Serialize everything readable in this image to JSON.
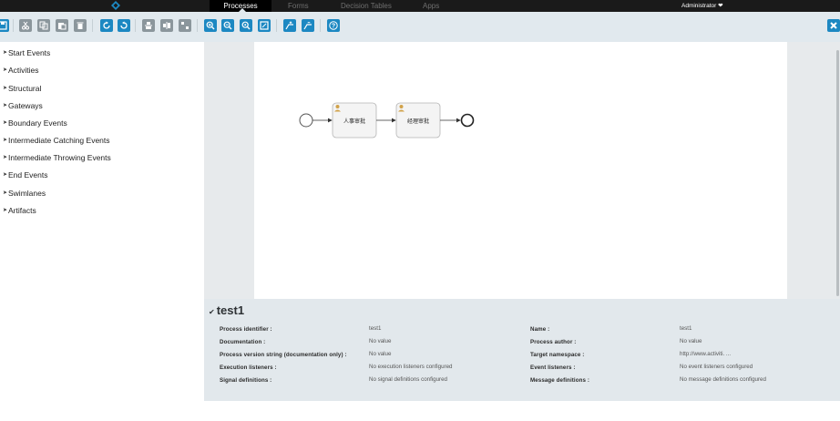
{
  "nav": {
    "tabs": [
      {
        "label": "Processes",
        "active": true
      },
      {
        "label": "Forms",
        "active": false
      },
      {
        "label": "Decision Tables",
        "active": false
      },
      {
        "label": "Apps",
        "active": false
      }
    ],
    "user": "Administrator"
  },
  "toolbar": {
    "buttons": [
      "save-icon",
      "cut-icon",
      "copy-icon",
      "paste-icon",
      "delete-icon",
      "redo-icon",
      "undo-icon",
      "align-vertical-icon",
      "align-horizontal-icon",
      "same-size-icon",
      "zoom-in-icon",
      "zoom-out-icon",
      "zoom-actual-icon",
      "zoom-fit-icon",
      "bendpoint-add-icon",
      "bendpoint-remove-icon",
      "help-icon",
      "close-icon"
    ]
  },
  "palette": {
    "items": [
      "Start Events",
      "Activities",
      "Structural",
      "Gateways",
      "Boundary Events",
      "Intermediate Catching Events",
      "Intermediate Throwing Events",
      "End Events",
      "Swimlanes",
      "Artifacts"
    ]
  },
  "diagram": {
    "tasks": [
      {
        "label": "人事审批"
      },
      {
        "label": "经理审批"
      }
    ]
  },
  "properties": {
    "title": "test1",
    "rows": [
      {
        "l1": "Process identifier :",
        "v1": "test1",
        "l2": "Name :",
        "v2": "test1"
      },
      {
        "l1": "Documentation :",
        "v1": "No value",
        "l2": "Process author :",
        "v2": "No value"
      },
      {
        "l1": "Process version string (documentation only) :",
        "v1": "No value",
        "l2": "Target namespace :",
        "v2": "http://www.activiti. ..."
      },
      {
        "l1": "Execution listeners :",
        "v1": "No execution listeners configured",
        "l2": "Event listeners :",
        "v2": "No event listeners configured"
      },
      {
        "l1": "Signal definitions :",
        "v1": "No signal definitions configured",
        "l2": "Message definitions :",
        "v2": "No message definitions configured"
      }
    ]
  },
  "colors": {
    "accent": "#1c88c2",
    "toolbar_bg": "#e1e9ee",
    "nav_bg": "#1a1a1a"
  }
}
